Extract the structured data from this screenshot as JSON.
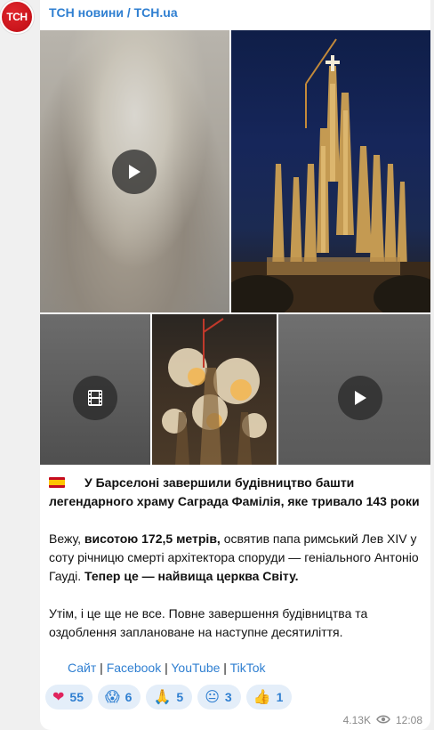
{
  "channel": {
    "avatar_text": "ТСН",
    "name": "ТСН новини / TCH.ua"
  },
  "media": [
    {
      "type": "video",
      "icon": "play-icon"
    },
    {
      "type": "photo",
      "description_icon": "none"
    },
    {
      "type": "video-album",
      "icon": "film-icon"
    },
    {
      "type": "photo"
    },
    {
      "type": "video",
      "icon": "play-icon"
    }
  ],
  "post": {
    "flag": "Spain flag",
    "headline": "У Барселоні завершили будівництво башти легендарного храму Саграда Фамілія, яке тривало 143 роки",
    "para1_a": "Вежу, ",
    "para1_b": "висотою 172,5 метрів,",
    "para1_c": " освятив папа римський Лев XIV у соту річницю смерті архітектора споруди — геніального Антоніо Гауді. ",
    "para1_d": "Тепер це — найвища церква Світу.",
    "para2": "Утім, і це ще не все. Повне завершення будівництва та оздоблення заплановане на наступне десятиліття."
  },
  "links": {
    "site": "Сайт",
    "sep": " | ",
    "facebook": "Facebook",
    "youtube": "YouTube",
    "tiktok": "TikTok"
  },
  "reactions": [
    {
      "emoji": "❤",
      "count": "55",
      "icon": "heart-icon"
    },
    {
      "emoji": "😱",
      "count": "6",
      "icon": "scream-icon"
    },
    {
      "emoji": "🙏",
      "count": "5",
      "icon": "pray-icon"
    },
    {
      "emoji": "😐",
      "count": "3",
      "icon": "neutral-face-icon"
    },
    {
      "emoji": "👍",
      "count": "1",
      "icon": "thumbs-up-icon"
    }
  ],
  "meta": {
    "views": "4.13K",
    "time": "12:08"
  },
  "colors": {
    "accent": "#2f7fd1",
    "brand_red": "#c8141b",
    "reaction_bg": "#e4eef9"
  }
}
